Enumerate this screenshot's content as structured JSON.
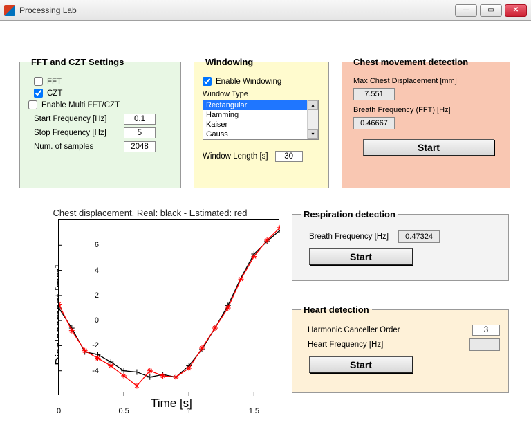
{
  "window": {
    "title": "Processing Lab"
  },
  "fft": {
    "legend": "FFT and CZT Settings",
    "fft_label": "FFT",
    "fft_checked": false,
    "czt_label": "CZT",
    "czt_checked": true,
    "multi_label": "Enable Multi FFT/CZT",
    "multi_checked": false,
    "start_freq_label": "Start Frequency [Hz]",
    "start_freq": "0.1",
    "stop_freq_label": "Stop Frequency [Hz]",
    "stop_freq": "5",
    "nsamp_label": "Num. of samples",
    "nsamp": "2048"
  },
  "win": {
    "legend": "Windowing",
    "enable_label": "Enable Windowing",
    "enable_checked": true,
    "type_label": "Window Type",
    "options": [
      "Rectangular",
      "Hamming",
      "Kaiser",
      "Gauss"
    ],
    "selected_index": 0,
    "len_label": "Window Length [s]",
    "len": "30"
  },
  "chest": {
    "legend": "Chest movement detection",
    "max_disp_label": "Max Chest Displacement [mm]",
    "max_disp": "7.551",
    "bf_label": "Breath Frequency (FFT) [Hz]",
    "bf": "0.46667",
    "start": "Start"
  },
  "resp": {
    "legend": "Respiration detection",
    "bf_label": "Breath Frequency [Hz]",
    "bf": "0.47324",
    "start": "Start"
  },
  "heart": {
    "legend": "Heart detection",
    "hc_label": "Harmonic Canceller Order",
    "hc": "3",
    "hf_label": "Heart Frequency [Hz]",
    "hf": "",
    "start": "Start"
  },
  "chart": {
    "title": "Chest displacement. Real: black - Estimated: red",
    "xlabel": "Time [s]",
    "ylabel": "Displacement [mm]"
  },
  "chart_data": {
    "type": "line",
    "title": "Chest displacement. Real: black - Estimated: red",
    "xlabel": "Time [s]",
    "ylabel": "Displacement [mm]",
    "xlim": [
      0,
      1.7
    ],
    "ylim": [
      -6,
      8
    ],
    "xticks": [
      0,
      0.5,
      1,
      1.5
    ],
    "yticks": [
      -4,
      -2,
      0,
      2,
      4,
      6
    ],
    "x": [
      0.0,
      0.1,
      0.2,
      0.3,
      0.4,
      0.5,
      0.6,
      0.7,
      0.8,
      0.9,
      1.0,
      1.1,
      1.2,
      1.3,
      1.4,
      1.5,
      1.6,
      1.7
    ],
    "series": [
      {
        "name": "Real",
        "color": "#000000",
        "marker": "+",
        "values": [
          1.0,
          -0.6,
          -2.5,
          -2.7,
          -3.3,
          -4.0,
          -4.1,
          -4.5,
          -4.3,
          -4.5,
          -3.6,
          -2.3,
          -0.6,
          1.2,
          3.4,
          5.3,
          6.3,
          7.2
        ]
      },
      {
        "name": "Estimated",
        "color": "#ff0000",
        "marker": "*",
        "values": [
          1.3,
          -0.8,
          -2.4,
          -3.0,
          -3.6,
          -4.4,
          -5.2,
          -4.0,
          -4.4,
          -4.5,
          -3.8,
          -2.2,
          -0.6,
          1.0,
          3.3,
          5.1,
          6.4,
          7.4
        ]
      }
    ]
  }
}
